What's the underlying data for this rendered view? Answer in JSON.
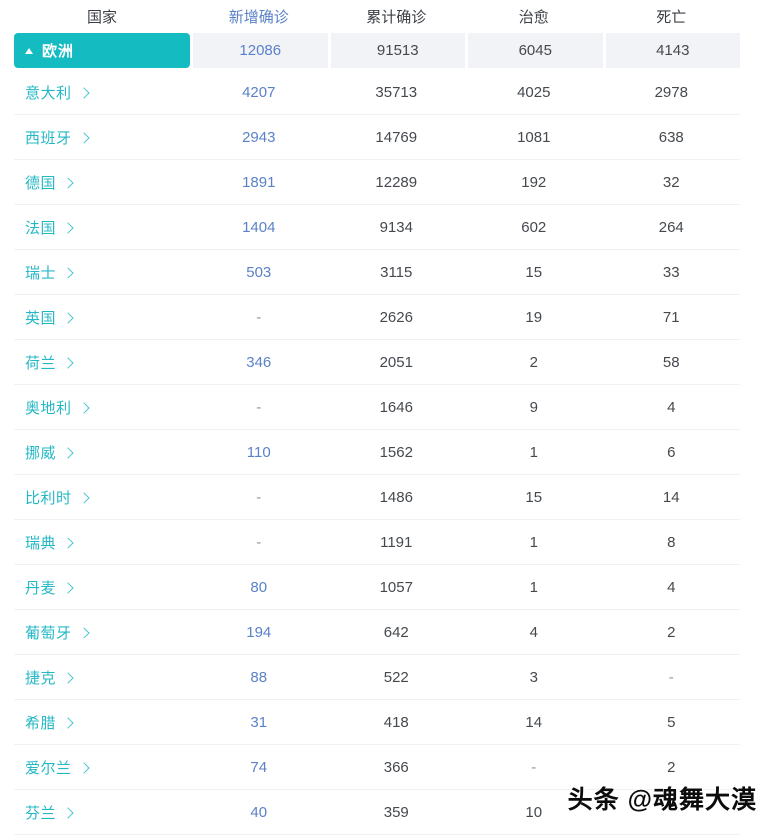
{
  "colors": {
    "accent_teal": "#14bcc2",
    "country_text_teal": "#24b8c6",
    "link_blue": "#5b82c8",
    "number_text": "#45494e",
    "group_row_bg": "#f1f3f6",
    "row_divider": "#f0f1f3"
  },
  "table": {
    "headers": [
      "国家",
      "新增确诊",
      "累计确诊",
      "治愈",
      "死亡"
    ],
    "sorted_column": "新增确诊",
    "group": {
      "name": "欧洲",
      "collapse_icon": "triangle-up-icon",
      "values": [
        "12086",
        "91513",
        "6045",
        "4143"
      ]
    },
    "rows": [
      {
        "name": "意大利",
        "new": "4207",
        "total": "35713",
        "cured": "4025",
        "dead": "2978"
      },
      {
        "name": "西班牙",
        "new": "2943",
        "total": "14769",
        "cured": "1081",
        "dead": "638"
      },
      {
        "name": "德国",
        "new": "1891",
        "total": "12289",
        "cured": "192",
        "dead": "32"
      },
      {
        "name": "法国",
        "new": "1404",
        "total": "9134",
        "cured": "602",
        "dead": "264"
      },
      {
        "name": "瑞士",
        "new": "503",
        "total": "3115",
        "cured": "15",
        "dead": "33"
      },
      {
        "name": "英国",
        "new": "-",
        "total": "2626",
        "cured": "19",
        "dead": "71"
      },
      {
        "name": "荷兰",
        "new": "346",
        "total": "2051",
        "cured": "2",
        "dead": "58"
      },
      {
        "name": "奥地利",
        "new": "-",
        "total": "1646",
        "cured": "9",
        "dead": "4"
      },
      {
        "name": "挪威",
        "new": "110",
        "total": "1562",
        "cured": "1",
        "dead": "6"
      },
      {
        "name": "比利时",
        "new": "-",
        "total": "1486",
        "cured": "15",
        "dead": "14"
      },
      {
        "name": "瑞典",
        "new": "-",
        "total": "1191",
        "cured": "1",
        "dead": "8"
      },
      {
        "name": "丹麦",
        "new": "80",
        "total": "1057",
        "cured": "1",
        "dead": "4"
      },
      {
        "name": "葡萄牙",
        "new": "194",
        "total": "642",
        "cured": "4",
        "dead": "2"
      },
      {
        "name": "捷克",
        "new": "88",
        "total": "522",
        "cured": "3",
        "dead": "-"
      },
      {
        "name": "希腊",
        "new": "31",
        "total": "418",
        "cured": "14",
        "dead": "5"
      },
      {
        "name": "爱尔兰",
        "new": "74",
        "total": "366",
        "cured": "-",
        "dead": "2"
      },
      {
        "name": "芬兰",
        "new": "40",
        "total": "359",
        "cured": "10",
        "dead": ""
      }
    ]
  },
  "watermark": "头条 @魂舞大漠"
}
